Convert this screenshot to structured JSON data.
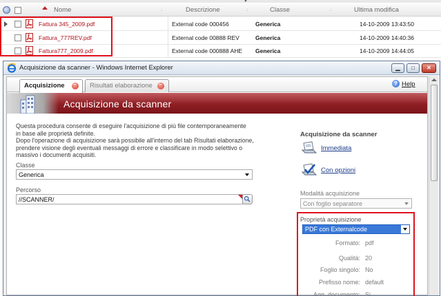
{
  "file_list": {
    "columns": {
      "name": "Nome",
      "description": "Descrizione",
      "class": "Classe",
      "last_modified": "Ultima modifica"
    },
    "rows": [
      {
        "name": "Fattura 345_2009.pdf",
        "description": "External code 000456",
        "class": "Generica",
        "last_modified": "14-10-2009 13:43:50"
      },
      {
        "name": "Fattura_777REV.pdf",
        "description": "External code 00888 REV",
        "class": "Generica",
        "last_modified": "14-10-2009 14:40:36"
      },
      {
        "name": "Fattura777_2009.pdf",
        "description": "External code 000888 AHE",
        "class": "Generica",
        "last_modified": "14-10-2009 14:44:05"
      }
    ]
  },
  "window": {
    "title": "Acquisizione da scanner - Windows Internet Explorer"
  },
  "tabs": [
    {
      "label": "Acquisizione",
      "active": true
    },
    {
      "label": "Risultati elaborazione",
      "active": false
    }
  ],
  "help_label": "Help",
  "banner_title": "Acquisizione da scanner",
  "intro_lines": [
    "Questa procedura consente di eseguire l'acquisizione di più file contemporaneamente",
    "in base alle proprietà definite.",
    "Dopo l'operazione di acquisizione sarà possibile all'interno del tab Risultati elaborazione,",
    "prendere visione degli eventuali messaggi di errore e classificare in modo selettivo o",
    "massivo i documenti acquisiti."
  ],
  "form": {
    "class_label": "Classe",
    "class_value": "Generica",
    "path_label": "Percorso",
    "path_value": "//SCANNER/"
  },
  "right_panel": {
    "title": "Acquisizione da scanner",
    "action_immediate": "Immediata",
    "action_options": "Con opzioni",
    "mode_label": "Modalità acquisizione",
    "mode_value": "Con foglio separatore",
    "props_label": "Proprietà acquisizione",
    "props_value": "PDF con Externalcode",
    "properties": [
      {
        "key": "Formato:",
        "value": "pdf"
      },
      {
        "key": "Qualità:",
        "value": "20"
      },
      {
        "key": "Foglio singolo:",
        "value": "No"
      },
      {
        "key": "Prefisso nome:",
        "value": "default"
      },
      {
        "key": "Agg. documento:",
        "value": "Si"
      }
    ]
  },
  "colors": {
    "highlight": "#e0101a",
    "banner": "#8e1f24",
    "link": "#1f3d8a",
    "selected": "#3a79d8",
    "file_name": "#b0101a"
  }
}
